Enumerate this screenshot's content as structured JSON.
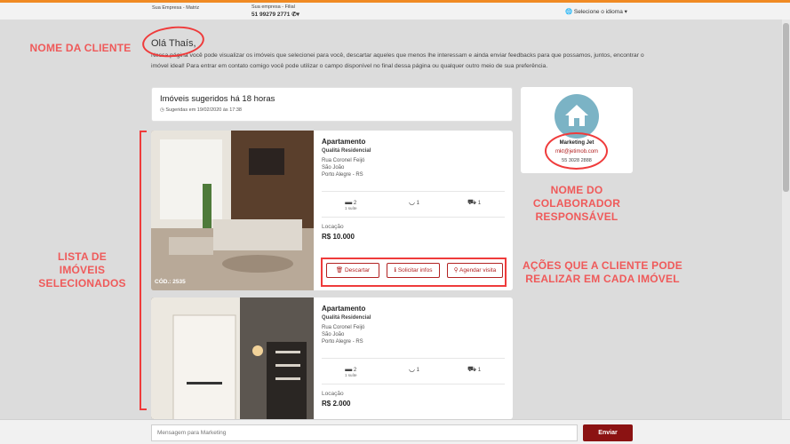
{
  "topbar": {
    "company_main": "Sua Empresa - Matriz",
    "company_branch": "Sua empresa - Filial",
    "branch_phone": "51 99279 2771",
    "language_label": "Selecione o idioma"
  },
  "greeting": "Olá Thaís,",
  "intro": "Nessa página você pode visualizar os imóveis que selecionei para você, descartar aqueles que menos lhe interessam e ainda enviar feedbacks para que possamos, juntos, encontrar o imóvel ideal! Para entrar em contato comigo você pode utilizar o campo disponível no final dessa página ou qualquer outro meio de sua preferência.",
  "suggested": {
    "title": "Imóveis sugeridos há 18 horas",
    "date": "Sugeridas em 19/02/2020 às 17:38"
  },
  "properties": [
    {
      "type": "Apartamento",
      "building": "Qualitá Residencial",
      "street": "Rua Coronel Feijó",
      "district": "São João",
      "city": "Porto Alegre - RS",
      "bedrooms": "2",
      "suites": "1 suíte",
      "bathrooms": "1",
      "parking": "1",
      "location_label": "Locação",
      "price": "R$ 10.000",
      "code": "CÓD.: 2535"
    },
    {
      "type": "Apartamento",
      "building": "Qualitá Residencial",
      "street": "Rua Coronel Feijó",
      "district": "São João",
      "city": "Porto Alegre - RS",
      "bedrooms": "2",
      "suites": "1 suíte",
      "bathrooms": "1",
      "parking": "1",
      "location_label": "Locação",
      "price": "R$ 2.000"
    }
  ],
  "actions": {
    "discard": "Descartar",
    "request": "Solicitar infos",
    "schedule": "Agendar visita"
  },
  "collaborator": {
    "name": "Marketing Jet",
    "email": "mkt@jetimob.com",
    "phone": "55 3028 2888"
  },
  "annotations": {
    "client_name": "NOME DA CLIENTE",
    "property_list": "LISTA DE IMÓVEIS SELECIONADOS",
    "collaborator": "NOME DO COLABORADOR RESPONSÁVEL",
    "actions": "AÇÕES QUE A CLIENTE PODE REALIZAR EM CADA IMÓVEL"
  },
  "message": {
    "placeholder": "Mensagem para Marketing",
    "send_label": "Enviar"
  },
  "colors": {
    "accent": "#f08a24",
    "annotation": "#ef5a5a",
    "action_red": "#b22222",
    "send_button": "#8b1212",
    "avatar": "#7bb3c5"
  }
}
